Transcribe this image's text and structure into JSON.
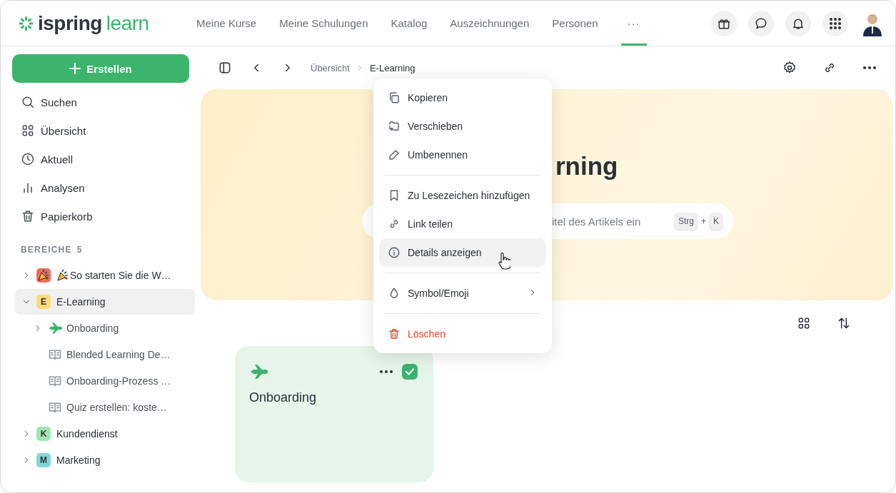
{
  "header": {
    "logo": {
      "word_1": "ispring",
      "word_2": "learn"
    },
    "nav": [
      {
        "label": "Meine Kurse",
        "selected": false
      },
      {
        "label": "Meine Schulungen",
        "selected": false
      },
      {
        "label": "Katalog",
        "selected": false
      },
      {
        "label": "Auszeichnungen",
        "selected": false
      },
      {
        "label": "Personen",
        "selected": false
      },
      {
        "label": "···",
        "selected": true
      }
    ]
  },
  "sidebar": {
    "create_button": "Erstellen",
    "items": [
      {
        "label": "Suchen"
      },
      {
        "label": "Übersicht"
      },
      {
        "label": "Aktuell"
      },
      {
        "label": "Analysen"
      },
      {
        "label": "Papierkorb"
      }
    ],
    "section": {
      "title": "BEREICHE",
      "count": "5"
    },
    "tree": [
      {
        "kind": "space",
        "label": "So starten Sie die W…",
        "color": "#f26b5b",
        "expanded": false,
        "selected": false
      },
      {
        "kind": "space",
        "badge": "E",
        "label": "E-Learning",
        "color": "#fcd97a",
        "expanded": true,
        "selected": true,
        "children": [
          {
            "kind": "folder",
            "label": "Onboarding",
            "expanded": false,
            "selected": false
          },
          {
            "kind": "article",
            "label": "Blended Learning De…",
            "selected": false
          },
          {
            "kind": "article",
            "label": "Onboarding-Prozess …",
            "selected": false
          },
          {
            "kind": "article",
            "label": "Quiz erstellen: koste…",
            "selected": false
          }
        ]
      },
      {
        "kind": "space",
        "badge": "K",
        "label": "Kundendienst",
        "color": "#9ee6b8",
        "expanded": false,
        "selected": false
      },
      {
        "kind": "space",
        "badge": "M",
        "label": "Marketing",
        "color": "#7ed9d6",
        "expanded": false,
        "selected": false
      }
    ]
  },
  "toolbar": {
    "breadcrumb": [
      "Übersicht",
      "E-Learning"
    ]
  },
  "hero": {
    "title": "rning",
    "search": {
      "placeholder": "itel des Artikels ein",
      "shortcut": [
        "Strg",
        "+",
        "K"
      ]
    }
  },
  "cards": [
    {
      "title": "Onboarding",
      "checked": true
    }
  ],
  "context_menu": {
    "groups": [
      [
        {
          "kind": "item",
          "label": "Kopieren",
          "hovered": false
        },
        {
          "kind": "item",
          "label": "Verschieben",
          "hovered": false
        },
        {
          "kind": "item",
          "label": "Umbenennen",
          "hovered": false
        }
      ],
      [
        {
          "kind": "item",
          "label": "Zu Lesezeichen hinzufügen",
          "hovered": false
        },
        {
          "kind": "item",
          "label": "Link teilen",
          "hovered": false
        },
        {
          "kind": "item",
          "label": "Details anzeigen",
          "hovered": true
        }
      ],
      [
        {
          "kind": "submenu",
          "label": "Symbol/Emoji",
          "hovered": false
        }
      ],
      [
        {
          "kind": "danger",
          "label": "Löschen",
          "hovered": false
        }
      ]
    ]
  }
}
